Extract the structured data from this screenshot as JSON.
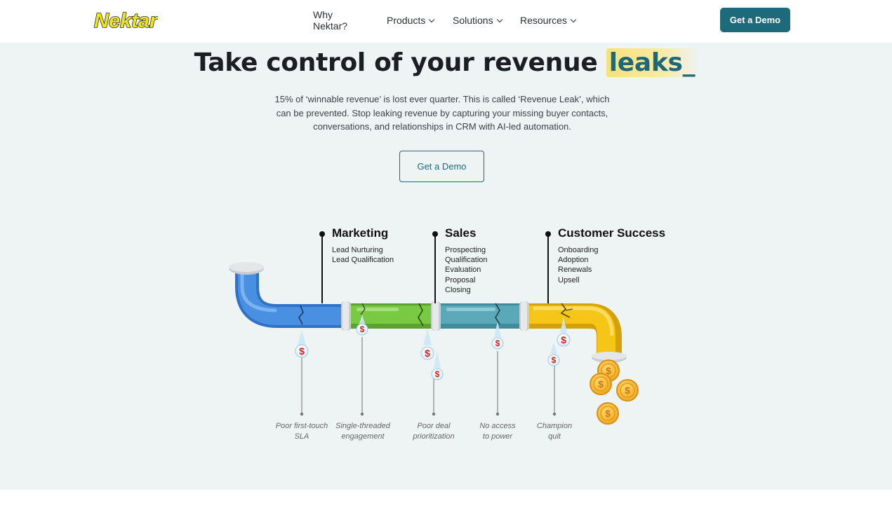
{
  "nav": {
    "logo_text": "Nektar",
    "links": [
      {
        "label": "Why Nektar?",
        "has_dropdown": false
      },
      {
        "label": "Products",
        "has_dropdown": true
      },
      {
        "label": "Solutions",
        "has_dropdown": true
      },
      {
        "label": "Resources",
        "has_dropdown": true
      }
    ],
    "cta_label": "Get a Demo"
  },
  "hero": {
    "title_main": "Take control of your revenue",
    "title_highlight": "leaks_",
    "description": "15% of ‘winnable revenue’ is lost ever quarter. This is called ‘Revenue Leak’, which can be prevented. Stop leaking revenue by capturing your missing buyer contacts, conversations, and relationships in CRM with AI-led automation.",
    "cta_label": "Get a Demo"
  },
  "stages": [
    {
      "title": "Marketing",
      "items": [
        "Lead Nurturing",
        "Lead Qualification"
      ]
    },
    {
      "title": "Sales",
      "items": [
        "Prospecting",
        "Qualification",
        "Evaluation",
        "Proposal",
        "Closing"
      ]
    },
    {
      "title": "Customer Success",
      "items": [
        "Onboarding",
        "Adoption",
        "Renewals",
        "Upsell"
      ]
    }
  ],
  "leaks": [
    {
      "line1": "Poor first-touch",
      "line2": "SLA"
    },
    {
      "line1": "Single-threaded",
      "line2": "engagement"
    },
    {
      "line1": "Poor deal",
      "line2": "prioritization"
    },
    {
      "line1": "No access",
      "line2": "to power"
    },
    {
      "line1": "Champion",
      "line2": "quit"
    }
  ],
  "drop_symbol": "$",
  "colors": {
    "brand_teal": "#1d6a7a",
    "hero_bg": "#eef3f3",
    "pipe_blue": "#4a90e2",
    "pipe_green": "#7ac943",
    "pipe_teal": "#5aa8b8",
    "pipe_yellow": "#f5c518",
    "highlight_yellow": "#f7e17a",
    "coin_gold": "#f5b82a"
  }
}
